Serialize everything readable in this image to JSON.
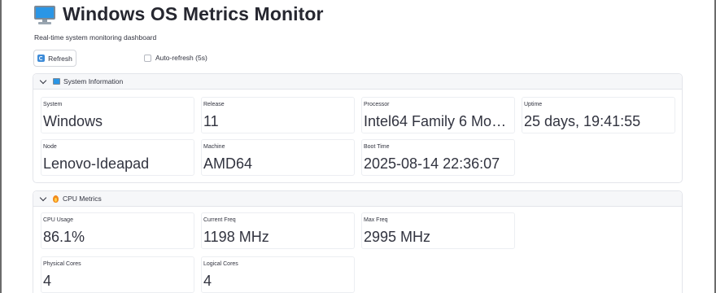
{
  "header": {
    "title": "Windows OS Metrics Monitor",
    "subtitle": "Real-time system monitoring dashboard",
    "icon": "desktop-computer-icon"
  },
  "controls": {
    "refresh_label": "Refresh",
    "auto_refresh_label": "Auto-refresh (5s)",
    "auto_refresh_checked": false
  },
  "system_info": {
    "title": "System Information",
    "metrics": [
      {
        "label": "System",
        "value": "Windows"
      },
      {
        "label": "Release",
        "value": "11"
      },
      {
        "label": "Processor",
        "value": "Intel64 Family 6 Mod..."
      },
      {
        "label": "Uptime",
        "value": "25 days, 19:41:55"
      },
      {
        "label": "Node",
        "value": "Lenovo-Ideapad"
      },
      {
        "label": "Machine",
        "value": "AMD64"
      },
      {
        "label": "Boot Time",
        "value": "2025-08-14 22:36:07"
      }
    ]
  },
  "cpu_metrics": {
    "title": "CPU Metrics",
    "metrics": [
      {
        "label": "CPU Usage",
        "value": "86.1%"
      },
      {
        "label": "Current Freq",
        "value": "1198 MHz"
      },
      {
        "label": "Max Freq",
        "value": "2995 MHz"
      },
      {
        "label": "Physical Cores",
        "value": "4"
      },
      {
        "label": "Logical Cores",
        "value": "4"
      }
    ]
  }
}
